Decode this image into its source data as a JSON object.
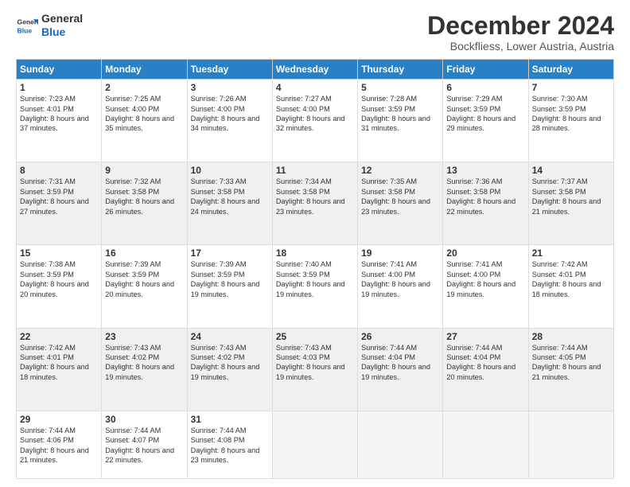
{
  "header": {
    "logo_line1": "General",
    "logo_line2": "Blue",
    "title": "December 2024",
    "subtitle": "Bockfliess, Lower Austria, Austria"
  },
  "days_of_week": [
    "Sunday",
    "Monday",
    "Tuesday",
    "Wednesday",
    "Thursday",
    "Friday",
    "Saturday"
  ],
  "weeks": [
    [
      {
        "day": "1",
        "sunrise": "7:23 AM",
        "sunset": "4:01 PM",
        "daylight": "8 hours and 37 minutes."
      },
      {
        "day": "2",
        "sunrise": "7:25 AM",
        "sunset": "4:00 PM",
        "daylight": "8 hours and 35 minutes."
      },
      {
        "day": "3",
        "sunrise": "7:26 AM",
        "sunset": "4:00 PM",
        "daylight": "8 hours and 34 minutes."
      },
      {
        "day": "4",
        "sunrise": "7:27 AM",
        "sunset": "4:00 PM",
        "daylight": "8 hours and 32 minutes."
      },
      {
        "day": "5",
        "sunrise": "7:28 AM",
        "sunset": "3:59 PM",
        "daylight": "8 hours and 31 minutes."
      },
      {
        "day": "6",
        "sunrise": "7:29 AM",
        "sunset": "3:59 PM",
        "daylight": "8 hours and 29 minutes."
      },
      {
        "day": "7",
        "sunrise": "7:30 AM",
        "sunset": "3:59 PM",
        "daylight": "8 hours and 28 minutes."
      }
    ],
    [
      {
        "day": "8",
        "sunrise": "7:31 AM",
        "sunset": "3:59 PM",
        "daylight": "8 hours and 27 minutes."
      },
      {
        "day": "9",
        "sunrise": "7:32 AM",
        "sunset": "3:58 PM",
        "daylight": "8 hours and 26 minutes."
      },
      {
        "day": "10",
        "sunrise": "7:33 AM",
        "sunset": "3:58 PM",
        "daylight": "8 hours and 24 minutes."
      },
      {
        "day": "11",
        "sunrise": "7:34 AM",
        "sunset": "3:58 PM",
        "daylight": "8 hours and 23 minutes."
      },
      {
        "day": "12",
        "sunrise": "7:35 AM",
        "sunset": "3:58 PM",
        "daylight": "8 hours and 23 minutes."
      },
      {
        "day": "13",
        "sunrise": "7:36 AM",
        "sunset": "3:58 PM",
        "daylight": "8 hours and 22 minutes."
      },
      {
        "day": "14",
        "sunrise": "7:37 AM",
        "sunset": "3:58 PM",
        "daylight": "8 hours and 21 minutes."
      }
    ],
    [
      {
        "day": "15",
        "sunrise": "7:38 AM",
        "sunset": "3:59 PM",
        "daylight": "8 hours and 20 minutes."
      },
      {
        "day": "16",
        "sunrise": "7:39 AM",
        "sunset": "3:59 PM",
        "daylight": "8 hours and 20 minutes."
      },
      {
        "day": "17",
        "sunrise": "7:39 AM",
        "sunset": "3:59 PM",
        "daylight": "8 hours and 19 minutes."
      },
      {
        "day": "18",
        "sunrise": "7:40 AM",
        "sunset": "3:59 PM",
        "daylight": "8 hours and 19 minutes."
      },
      {
        "day": "19",
        "sunrise": "7:41 AM",
        "sunset": "4:00 PM",
        "daylight": "8 hours and 19 minutes."
      },
      {
        "day": "20",
        "sunrise": "7:41 AM",
        "sunset": "4:00 PM",
        "daylight": "8 hours and 19 minutes."
      },
      {
        "day": "21",
        "sunrise": "7:42 AM",
        "sunset": "4:01 PM",
        "daylight": "8 hours and 18 minutes."
      }
    ],
    [
      {
        "day": "22",
        "sunrise": "7:42 AM",
        "sunset": "4:01 PM",
        "daylight": "8 hours and 18 minutes."
      },
      {
        "day": "23",
        "sunrise": "7:43 AM",
        "sunset": "4:02 PM",
        "daylight": "8 hours and 19 minutes."
      },
      {
        "day": "24",
        "sunrise": "7:43 AM",
        "sunset": "4:02 PM",
        "daylight": "8 hours and 19 minutes."
      },
      {
        "day": "25",
        "sunrise": "7:43 AM",
        "sunset": "4:03 PM",
        "daylight": "8 hours and 19 minutes."
      },
      {
        "day": "26",
        "sunrise": "7:44 AM",
        "sunset": "4:04 PM",
        "daylight": "8 hours and 19 minutes."
      },
      {
        "day": "27",
        "sunrise": "7:44 AM",
        "sunset": "4:04 PM",
        "daylight": "8 hours and 20 minutes."
      },
      {
        "day": "28",
        "sunrise": "7:44 AM",
        "sunset": "4:05 PM",
        "daylight": "8 hours and 21 minutes."
      }
    ],
    [
      {
        "day": "29",
        "sunrise": "7:44 AM",
        "sunset": "4:06 PM",
        "daylight": "8 hours and 21 minutes."
      },
      {
        "day": "30",
        "sunrise": "7:44 AM",
        "sunset": "4:07 PM",
        "daylight": "8 hours and 22 minutes."
      },
      {
        "day": "31",
        "sunrise": "7:44 AM",
        "sunset": "4:08 PM",
        "daylight": "8 hours and 23 minutes."
      },
      null,
      null,
      null,
      null
    ]
  ],
  "labels": {
    "sunrise": "Sunrise: ",
    "sunset": "Sunset: ",
    "daylight": "Daylight: "
  }
}
